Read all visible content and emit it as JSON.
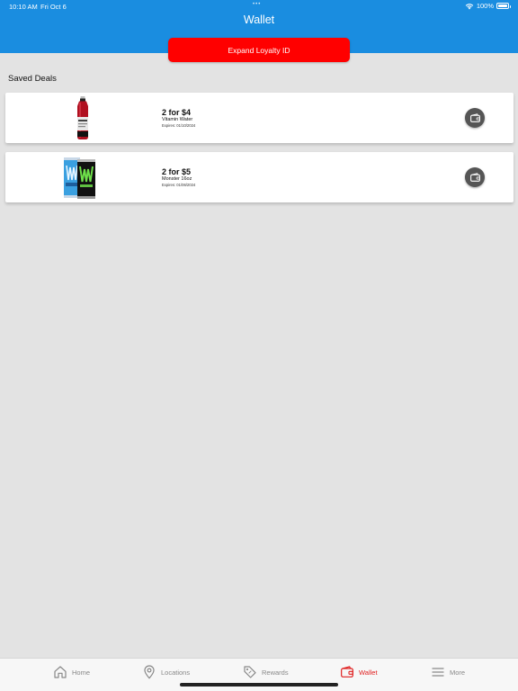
{
  "status_bar": {
    "time": "10:10 AM",
    "date": "Fri Oct 6",
    "battery": "100%"
  },
  "header": {
    "title": "Wallet",
    "loyalty_button_label": "Expand Loyalty ID",
    "background_color": "#1a8de0",
    "button_color": "#ff0000"
  },
  "saved_deals": {
    "title": "Saved Deals",
    "items": [
      {
        "title": "2 for $4",
        "product": "Vitamin Water",
        "expiry": "Expires: 01/10/2024",
        "image_icon": "vitamin-water-bottle"
      },
      {
        "title": "2 for $5",
        "product": "Monster 16oz",
        "expiry": "Expires: 01/06/2024",
        "image_icon": "monster-cans"
      }
    ]
  },
  "tab_bar": {
    "active": "wallet",
    "active_color": "#e02020",
    "items": [
      {
        "id": "home",
        "label": "Home",
        "icon": "home-icon"
      },
      {
        "id": "locations",
        "label": "Locations",
        "icon": "location-pin-icon"
      },
      {
        "id": "rewards",
        "label": "Rewards",
        "icon": "tag-icon"
      },
      {
        "id": "wallet",
        "label": "Wallet",
        "icon": "wallet-icon"
      },
      {
        "id": "more",
        "label": "More",
        "icon": "menu-icon"
      }
    ]
  }
}
